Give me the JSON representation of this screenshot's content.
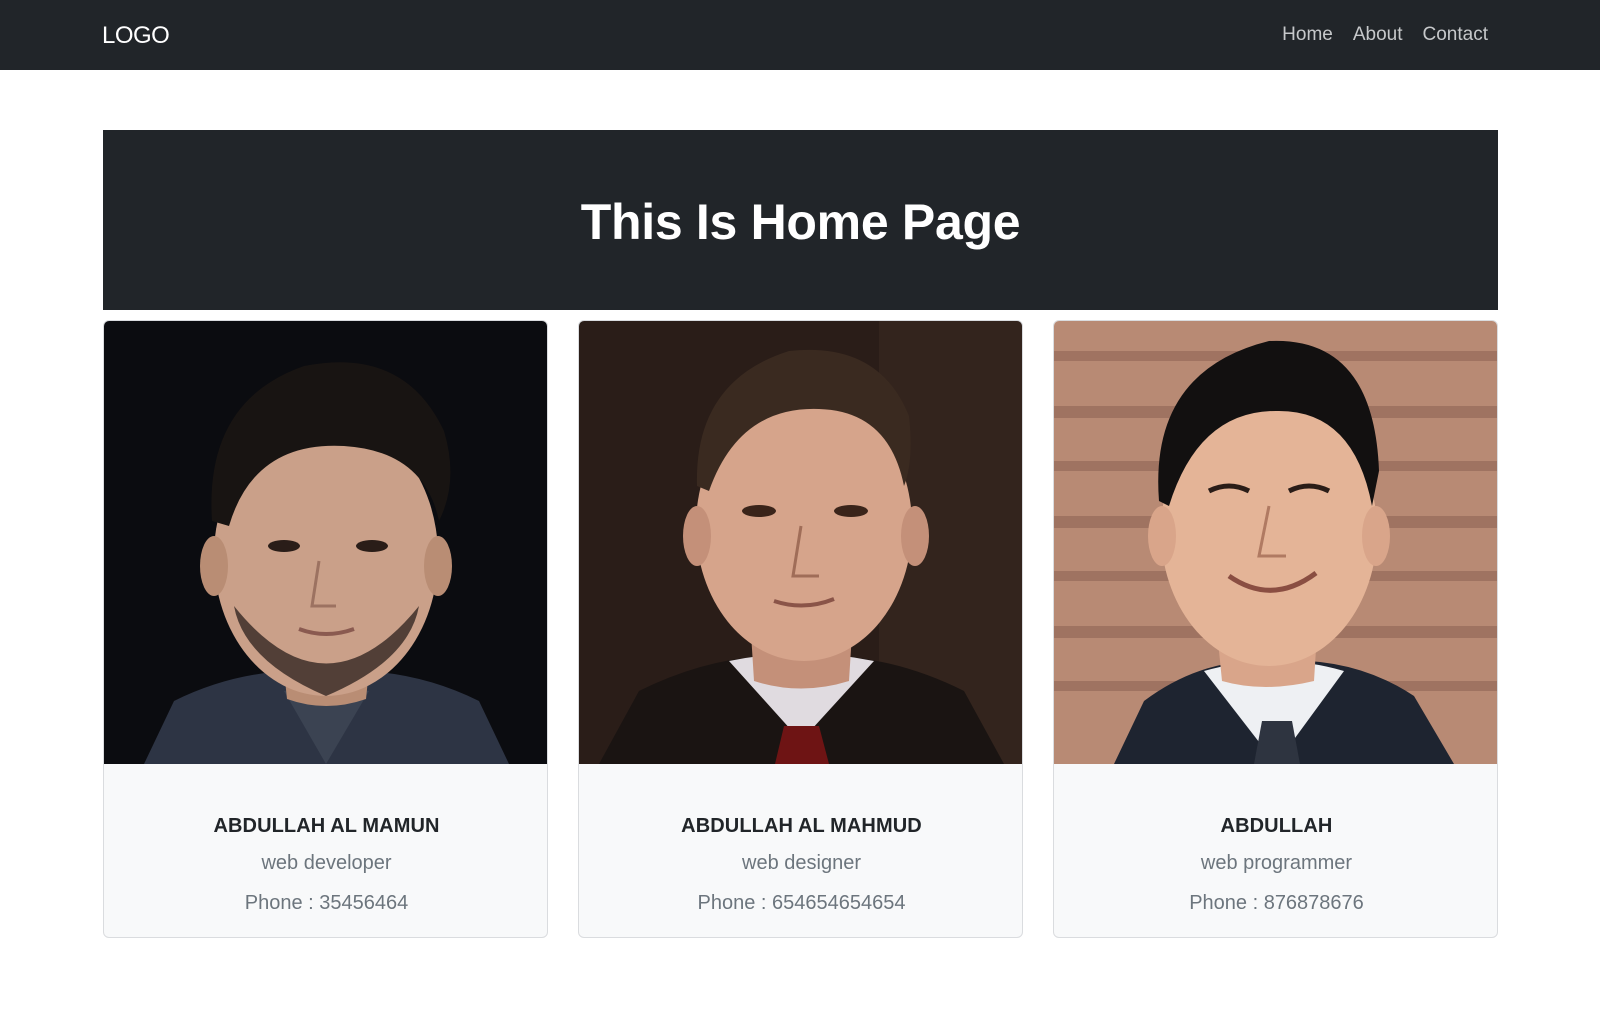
{
  "navbar": {
    "logo": "LOGO",
    "links": [
      {
        "label": "Home"
      },
      {
        "label": "About"
      },
      {
        "label": "Contact"
      }
    ]
  },
  "hero": {
    "title": "This Is Home Page"
  },
  "cards": [
    {
      "name": "ABDULLAH AL MAMUN",
      "role": "web developer",
      "phone": "Phone : 35456464"
    },
    {
      "name": "ABDULLAH AL MAHMUD",
      "role": "web designer",
      "phone": "Phone : 654654654654"
    },
    {
      "name": "ABDULLAH",
      "role": "web programmer",
      "phone": "Phone : 876878676"
    }
  ],
  "colors": {
    "dark": "#212529",
    "muted": "#6c757d",
    "card_bg": "#f8f9fa",
    "nav_link": "#c6c8ca"
  }
}
